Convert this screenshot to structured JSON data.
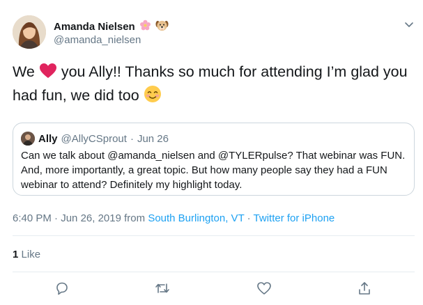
{
  "author": {
    "name": "Amanda Nielsen",
    "handle": "@amanda_nielsen",
    "name_emojis": [
      "cherry-blossom-icon",
      "dog-face-icon"
    ]
  },
  "tweet": {
    "text_part1": "We",
    "text_part2": "you Ally!! Thanks so much for attending I’m glad you had fun, we did too",
    "emojis": [
      "red-heart-icon",
      "smiling-face-icon"
    ]
  },
  "quoted_tweet": {
    "name": "Ally",
    "handle": "@AllyCSprout",
    "separator": "·",
    "date": "Jun 26",
    "text": "Can we talk about @amanda_nielsen and @TYLERpulse? That webinar was FUN. And, more importantly, a great topic. But how many people say they had a FUN webinar to attend? Definitely my highlight today."
  },
  "meta": {
    "time": "6:40 PM",
    "separator": "·",
    "date": "Jun 26, 2019",
    "from": "from",
    "location": "South Burlington, VT",
    "source": "Twitter for iPhone"
  },
  "stats": {
    "likes_count": "1",
    "likes_label": "Like"
  },
  "actions": [
    "reply-icon",
    "retweet-icon",
    "like-icon",
    "share-icon"
  ],
  "colors": {
    "text": "#14171a",
    "secondary": "#657786",
    "link": "#1da1f2",
    "border": "#ccd6dd",
    "divider": "#e6ecf0"
  }
}
